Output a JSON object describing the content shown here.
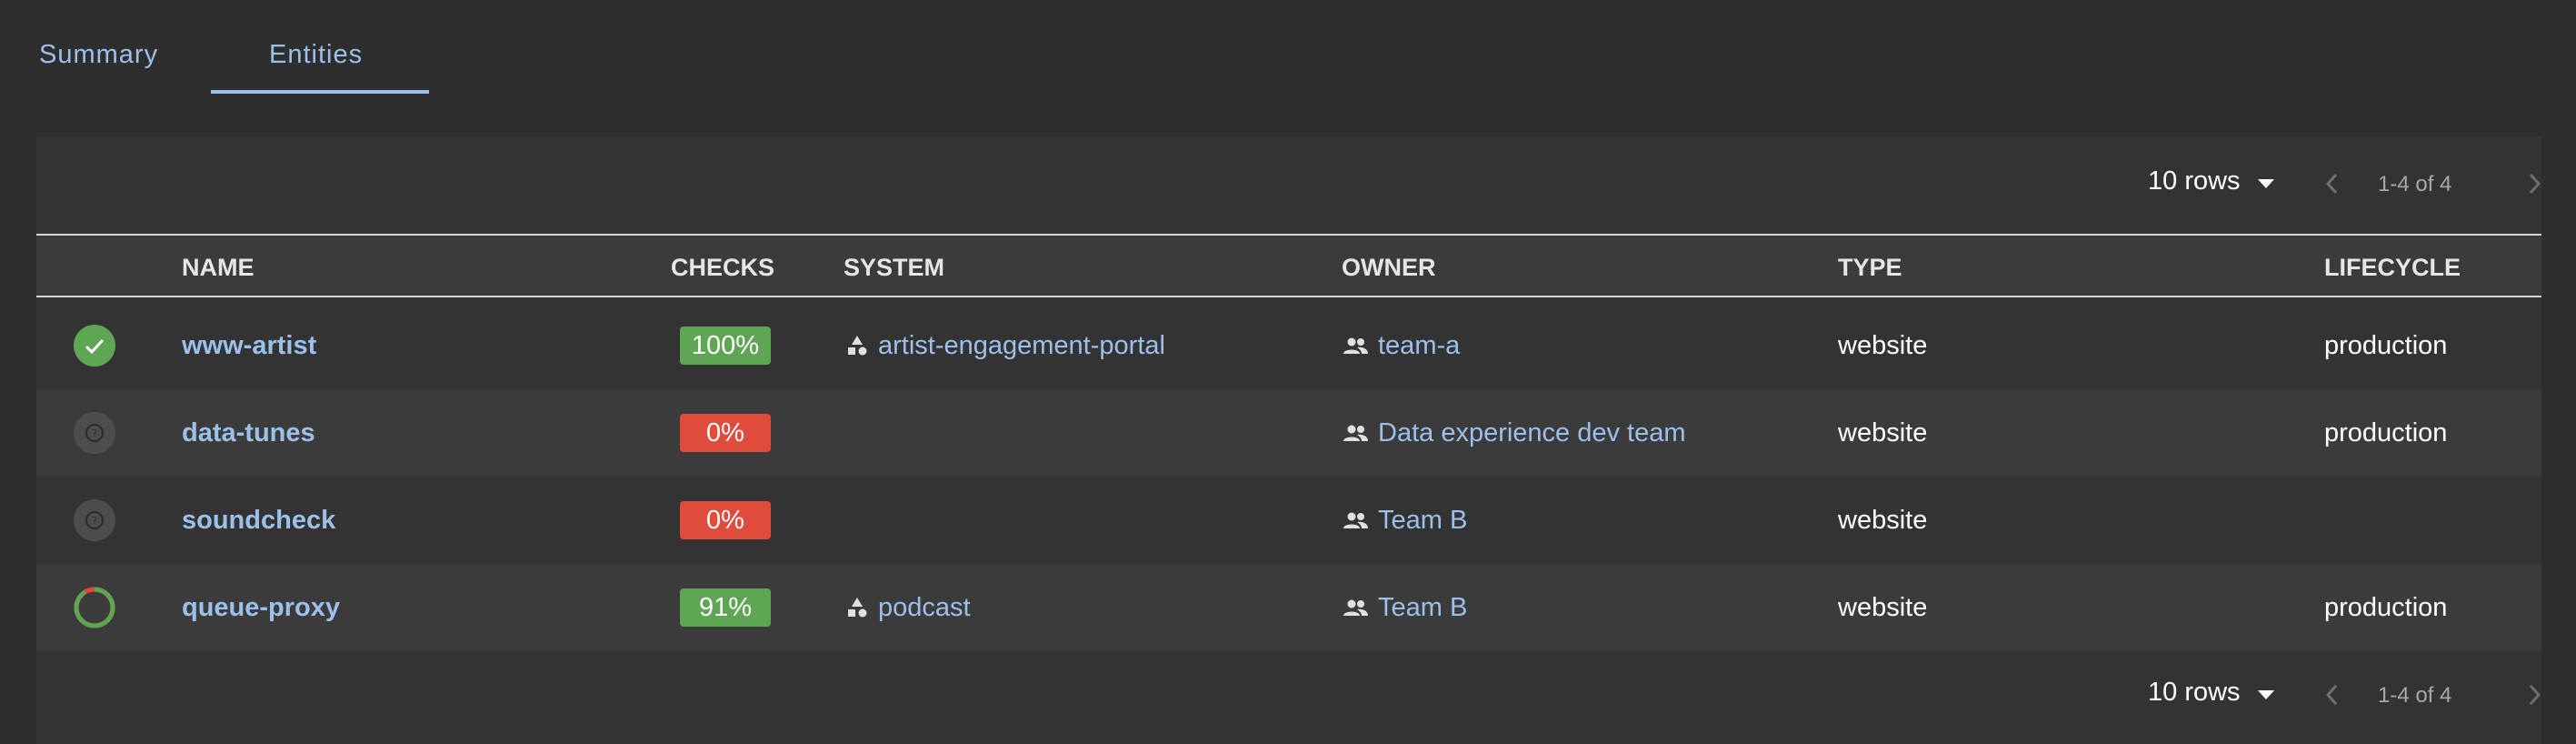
{
  "tabs": {
    "summary": "Summary",
    "entities": "Entities"
  },
  "pagination": {
    "rows_per_page": "10 rows",
    "range": "1-4 of 4"
  },
  "table": {
    "columns": {
      "name": "NAME",
      "checks": "CHECKS",
      "system": "SYSTEM",
      "owner": "OWNER",
      "type": "TYPE",
      "lifecycle": "LIFECYCLE"
    },
    "rows": [
      {
        "status": "passed",
        "name": "www-artist",
        "checks": "100%",
        "checks_status": "pass",
        "system": "artist-engagement-portal",
        "owner": "team-a",
        "type": "website",
        "lifecycle": "production"
      },
      {
        "status": "unknown",
        "name": "data-tunes",
        "checks": "0%",
        "checks_status": "fail",
        "system": "",
        "owner": "Data experience dev team",
        "type": "website",
        "lifecycle": "production"
      },
      {
        "status": "unknown",
        "name": "soundcheck",
        "checks": "0%",
        "checks_status": "fail",
        "system": "",
        "owner": "Team B",
        "type": "website",
        "lifecycle": ""
      },
      {
        "status": "partial",
        "progress": 0.91,
        "name": "queue-proxy",
        "checks": "91%",
        "checks_status": "pass",
        "system": "podcast",
        "owner": "Team B",
        "type": "website",
        "lifecycle": "production"
      }
    ]
  },
  "colors": {
    "accent": "#9cc0ea",
    "pass": "#5ea654",
    "fail": "#e04b3c",
    "unknown": "#4d4d4d",
    "background": "#2e2e2e",
    "panel": "#333333"
  },
  "icons": {
    "check": "check-circle-icon",
    "unknown": "help-circle-icon",
    "partial": "progress-ring-icon",
    "system": "shapes-icon",
    "owner": "group-icon",
    "rows_dropdown": "caret-down-icon",
    "prev": "chevron-left-icon",
    "next": "chevron-right-icon"
  }
}
